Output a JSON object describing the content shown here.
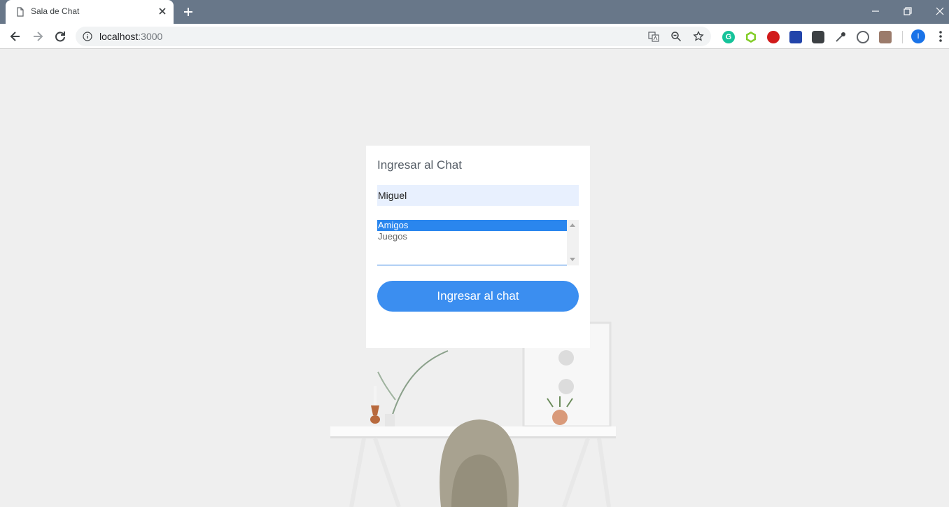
{
  "browser": {
    "tab": {
      "title": "Sala de Chat"
    },
    "address": {
      "host": "localhost",
      "port": ":3000"
    },
    "profile_initial": "I"
  },
  "colors": {
    "frame": "#687789",
    "accent": "#3b8ef0",
    "selection": "#2a86ee",
    "autofill": "#e8f0fe"
  },
  "icons": [
    "document-icon",
    "close-icon",
    "plus-icon",
    "back-icon",
    "forward-icon",
    "reload-icon",
    "info-icon",
    "translate-icon",
    "zoom-icon",
    "star-icon",
    "grammarly-icon",
    "node-icon",
    "adblock-icon",
    "bookmark-icon",
    "bulb-icon",
    "color-picker-icon",
    "code-icon",
    "pdf-icon",
    "menu-icon"
  ],
  "login": {
    "title": "Ingresar al Chat",
    "name_value": "Miguel",
    "rooms": [
      "Amigos",
      "Juegos"
    ],
    "selected_room": "Amigos",
    "submit_label": "Ingresar al chat"
  }
}
